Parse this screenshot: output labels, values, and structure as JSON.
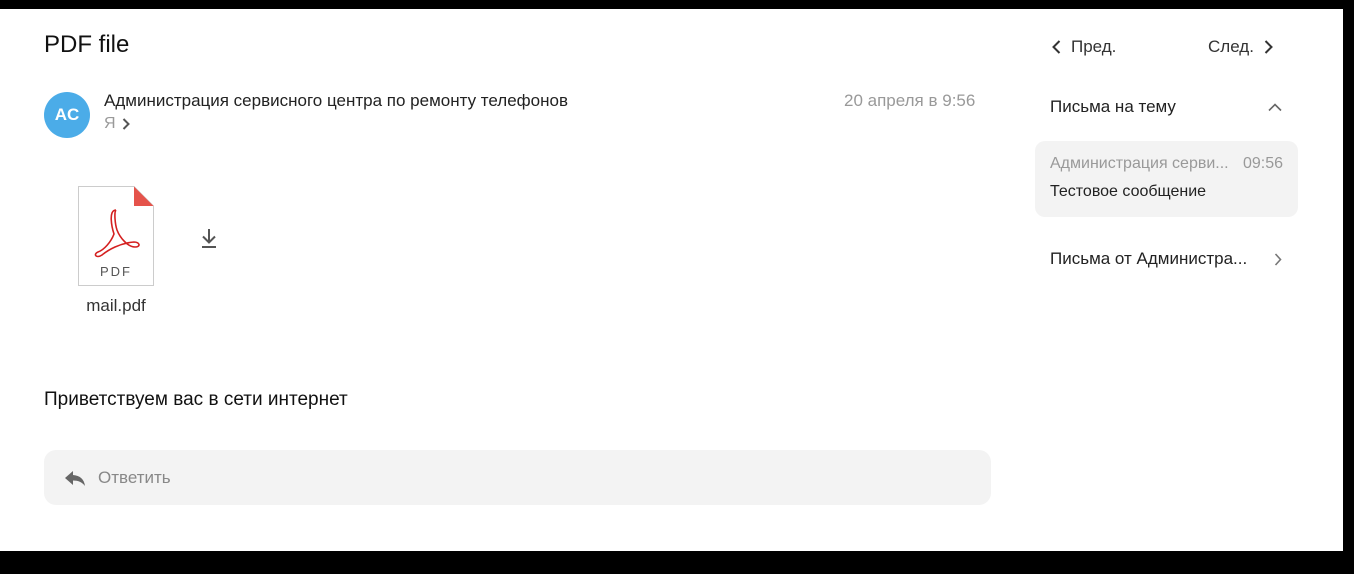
{
  "message": {
    "subject": "PDF file",
    "avatar_initials": "AC",
    "avatar_color": "#4bace8",
    "sender": "Администрация сервисного центра по ремонту телефонов",
    "recipient": "Я",
    "date": "20 апреля в 9:56",
    "attachment": {
      "type_label": "PDF",
      "file_name": "mail.pdf",
      "icon": "pdf-file-icon"
    },
    "body": "Приветствуем вас в сети интернет"
  },
  "reply": {
    "label": "Ответить",
    "icon": "reply-icon"
  },
  "navigation": {
    "prev_label": "Пред.",
    "next_label": "След."
  },
  "thread": {
    "header": "Письма на тему",
    "items": [
      {
        "sender": "Администрация серви...",
        "time": "09:56",
        "subject": "Тестовое сообщение"
      }
    ]
  },
  "from_sender": {
    "label": "Письма от Администра..."
  }
}
